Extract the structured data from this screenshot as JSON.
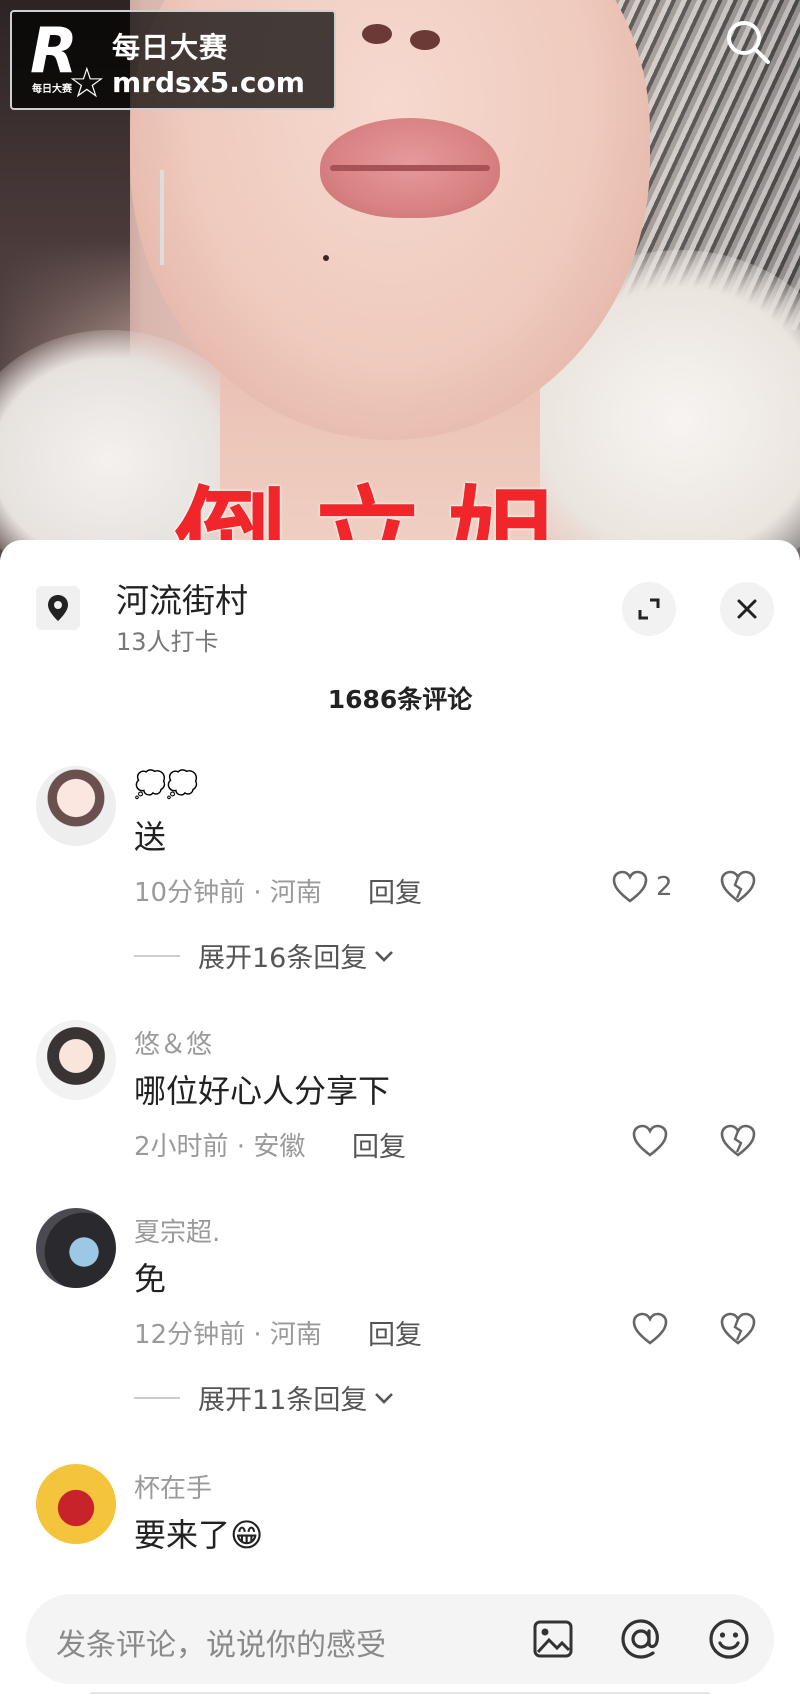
{
  "watermark": {
    "title": "每日大赛",
    "url": "mrdsx5.com",
    "logo_letter": "R",
    "logo_mini": "每日大赛"
  },
  "video": {
    "overlay_text": "倒立姐"
  },
  "location": {
    "name": "河流街村",
    "checkins": "13人打卡"
  },
  "comments_count": "1686条评论",
  "comments": [
    {
      "name": "💭💭",
      "text": "送",
      "meta": "10分钟前 · 河南",
      "reply": "回复",
      "likes": "2",
      "expand": "展开16条回复"
    },
    {
      "name": "悠＆悠",
      "text": "哪位好心人分享下",
      "meta": "2小时前 · 安徽",
      "reply": "回复",
      "likes": "",
      "expand": ""
    },
    {
      "name": "夏宗超.",
      "text": "免",
      "meta": "12分钟前 · 河南",
      "reply": "回复",
      "likes": "",
      "expand": "展开11条回复"
    },
    {
      "name": "杯在手",
      "text": "要来了😁",
      "meta": "",
      "reply": "",
      "likes": "",
      "expand": ""
    }
  ],
  "input": {
    "placeholder": "发条评论，说说你的感受"
  },
  "icons": [
    "search-icon",
    "location-pin-icon",
    "expand-icon",
    "close-icon",
    "heart-icon",
    "broken-heart-icon",
    "chevron-down-icon",
    "image-icon",
    "at-icon",
    "emoji-icon"
  ],
  "colors": {
    "overlay_red": "#f0262b",
    "sheet_bg": "#ffffff",
    "muted_text": "#9a9a9a"
  }
}
